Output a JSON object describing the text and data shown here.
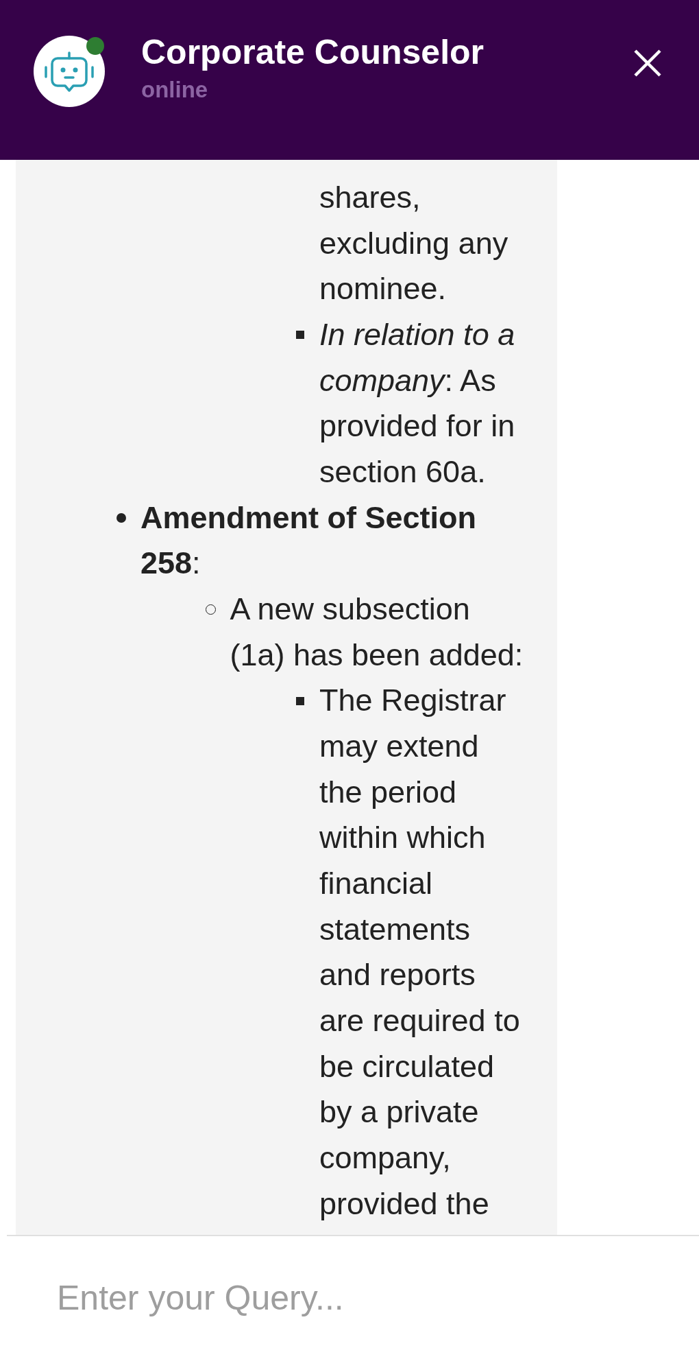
{
  "header": {
    "title": "Corporate Counselor",
    "status": "online",
    "online": true
  },
  "message": {
    "items": [
      {
        "children": [
          {
            "children": [
              {
                "tail": "shares, excluding any nominee."
              },
              {
                "text": "*In relation to a company*: As provided for in section 60a."
              }
            ]
          }
        ]
      },
      {
        "text": "**Amendment of Section 258**:",
        "children": [
          {
            "text": "A new subsection (1a) has been added:",
            "children": [
              {
                "text": "The Registrar may extend the period within which financial statements and reports are required to be circulated by a private company, provided the"
              }
            ]
          }
        ]
      }
    ]
  },
  "composer": {
    "placeholder": "Enter your Query..."
  }
}
